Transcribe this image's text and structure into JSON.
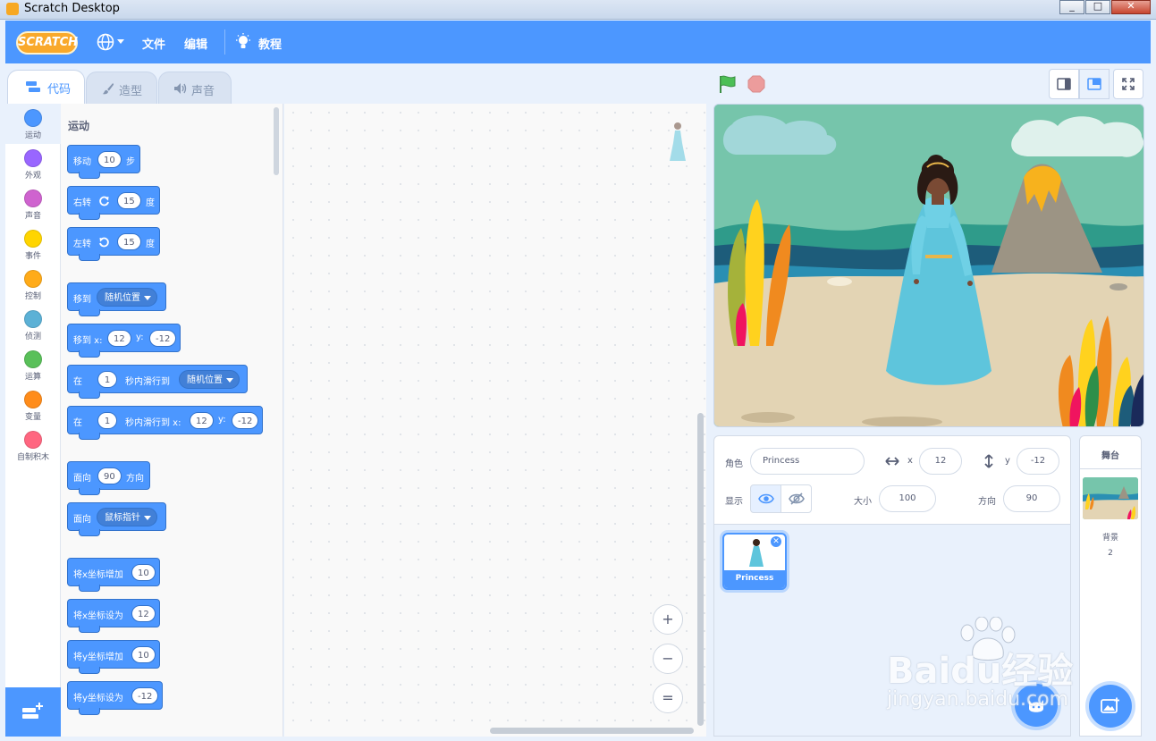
{
  "window": {
    "title": "Scratch Desktop"
  },
  "menubar": {
    "logo": "SCRATCH",
    "file": "文件",
    "edit": "编辑",
    "tutorials": "教程"
  },
  "tabs": [
    {
      "label": "代码",
      "active": true
    },
    {
      "label": "造型",
      "active": false
    },
    {
      "label": "声音",
      "active": false
    }
  ],
  "categories": [
    {
      "label": "运动",
      "color": "#4c97ff"
    },
    {
      "label": "外观",
      "color": "#9966ff"
    },
    {
      "label": "声音",
      "color": "#cf63cf"
    },
    {
      "label": "事件",
      "color": "#ffd500"
    },
    {
      "label": "控制",
      "color": "#ffab19"
    },
    {
      "label": "侦测",
      "color": "#5cb1d6"
    },
    {
      "label": "运算",
      "color": "#59c059"
    },
    {
      "label": "变量",
      "color": "#ff8c1a"
    },
    {
      "label": "自制积木",
      "color": "#ff6680"
    }
  ],
  "palette": {
    "title": "运动",
    "blocks": {
      "move": {
        "label": "移动",
        "steps": "10",
        "unit": "步"
      },
      "turn_right": {
        "label": "右转",
        "degrees": "15",
        "unit": "度"
      },
      "turn_left": {
        "label": "左转",
        "degrees": "15",
        "unit": "度"
      },
      "goto": {
        "label": "移到",
        "target": "随机位置"
      },
      "goto_xy": {
        "label": "移到 x:",
        "x": "12",
        "ylabel": "y:",
        "y": "-12"
      },
      "glide": {
        "label1": "在",
        "secs": "1",
        "label2": "秒内滑行到",
        "target": "随机位置"
      },
      "glide_xy": {
        "label1": "在",
        "secs": "1",
        "label2": "秒内滑行到 x:",
        "x": "12",
        "ylabel": "y:",
        "y": "-12"
      },
      "point_dir": {
        "label": "面向",
        "dir": "90",
        "unit": "方向"
      },
      "point_towards": {
        "label": "面向",
        "target": "鼠标指针"
      },
      "change_x": {
        "label": "将x坐标增加",
        "value": "10"
      },
      "set_x": {
        "label": "将x坐标设为",
        "value": "12"
      },
      "change_y": {
        "label": "将y坐标增加",
        "value": "10"
      },
      "set_y": {
        "label": "将y坐标设为",
        "value": "-12"
      }
    }
  },
  "zoom": {
    "in": "+",
    "out": "−",
    "reset": "="
  },
  "sprite_info": {
    "sprite_label": "角色",
    "sprite_name": "Princess",
    "x_label": "x",
    "x": "12",
    "y_label": "y",
    "y": "-12",
    "show_label": "显示",
    "size_label": "大小",
    "size": "100",
    "direction_label": "方向",
    "direction": "90"
  },
  "sprites": [
    {
      "name": "Princess",
      "selected": true
    }
  ],
  "stage_panel": {
    "title": "舞台",
    "backdrops_label": "背景",
    "backdrops_count": "2"
  },
  "watermark": {
    "brand": "Baidu经验",
    "url": "jingyan.baidu.com"
  },
  "colors": {
    "accent": "#4c97ff",
    "motion": "#4c97ff",
    "flag": "#4cbf56",
    "stop": "#ec9c9c"
  }
}
